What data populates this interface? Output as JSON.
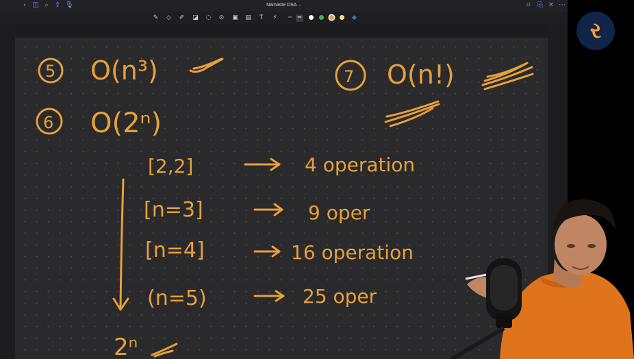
{
  "window": {
    "title": "Namaste DSA",
    "title_chevron": "⌄"
  },
  "titlebar_icons": [
    "back-icon",
    "sidebar-icon",
    "search-icon",
    "share-icon",
    "microphone-icon",
    "bookmark-icon",
    "export-icon",
    "close-icon",
    "more-icon"
  ],
  "toolbar": {
    "tools": [
      "pen-icon",
      "eraser-icon",
      "highlighter-icon",
      "shapes-icon",
      "lasso-icon",
      "camera-icon",
      "image-icon",
      "sticker-icon",
      "text-icon",
      "laser-icon"
    ],
    "colors": [
      "#ffffff",
      "#4caf50",
      "#e6a13a",
      "#f3e37a",
      "#2a7de1"
    ]
  },
  "notes": {
    "n5_label": "5",
    "n5_text": "O(n³)",
    "n6_label": "6",
    "n6_text": "O(2ⁿ)",
    "n7_label": "7",
    "n7_text": "O(n!)",
    "line1_left": "[2,2]",
    "line1_right": "4 operation",
    "line2_left": "[n=3]",
    "line2_right": "9 oper",
    "line3_left": "[n=4]",
    "line3_right": "16 operation",
    "line4_left": "(n=5)",
    "line4_right": "25 oper",
    "bottom": "2ⁿ"
  },
  "logo_text": "ર",
  "colors": {
    "ink": "#e6a13a",
    "canvas": "#2a2a2d",
    "logo_bg": "#11244a"
  }
}
